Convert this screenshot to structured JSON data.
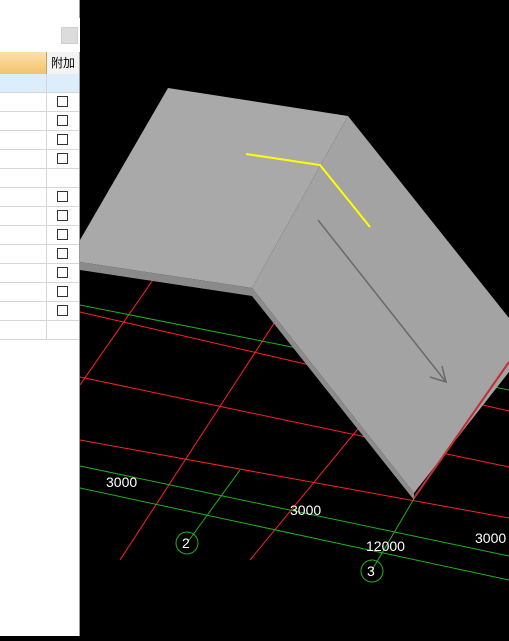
{
  "property_panel": {
    "column_header_extra": "附加",
    "rows": [
      {
        "selected": true,
        "checkbox": false
      },
      {
        "selected": false,
        "checkbox": true
      },
      {
        "selected": false,
        "checkbox": true
      },
      {
        "selected": false,
        "checkbox": true
      },
      {
        "selected": false,
        "checkbox": true
      },
      {
        "selected": false,
        "checkbox": false
      },
      {
        "selected": false,
        "checkbox": true
      },
      {
        "selected": false,
        "checkbox": true
      },
      {
        "selected": false,
        "checkbox": true
      },
      {
        "selected": false,
        "checkbox": true
      },
      {
        "selected": false,
        "checkbox": true
      },
      {
        "selected": false,
        "checkbox": true
      },
      {
        "selected": false,
        "checkbox": true
      },
      {
        "selected": false,
        "checkbox": false
      }
    ]
  },
  "viewport": {
    "dimensions": [
      "3000",
      "3000",
      "12000",
      "3000"
    ],
    "axis_labels": [
      "2",
      "3"
    ],
    "colors": {
      "background": "#000000",
      "roof": "#a8a8a8",
      "grid_red": "#ff2020",
      "grid_green": "#20b020",
      "sketch_line": "#ffff00"
    }
  }
}
